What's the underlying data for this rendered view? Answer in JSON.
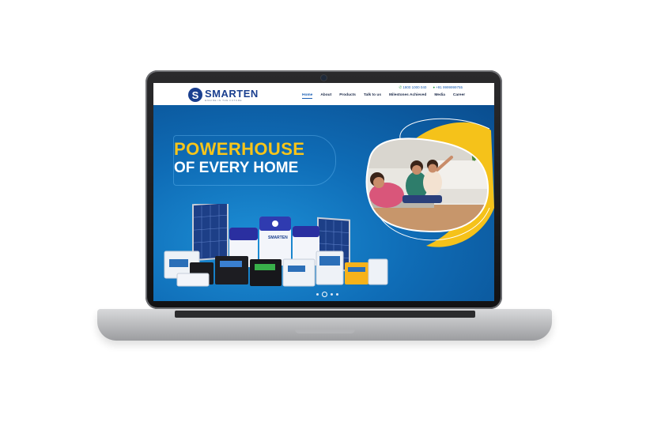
{
  "site": {
    "logo_letter": "S",
    "logo_name": "SMARTEN",
    "logo_tagline": "ENGINE IN THE FUTURE"
  },
  "contact": {
    "phone": "1800 1000 040",
    "whatsapp": "+91 9999999755"
  },
  "nav": {
    "items": [
      "Home",
      "About",
      "Products",
      "Talk to us",
      "Milestones Achieved",
      "Media",
      "Career"
    ],
    "active": "Home"
  },
  "hero": {
    "line1": "POWERHOUSE",
    "line2": "OF EVERY HOME",
    "product_brand": "SMARTEN"
  },
  "slider": {
    "count": 4,
    "active_index": 1
  },
  "colors": {
    "brand": "#1a3f8f",
    "accent": "#f7c51a",
    "hero_bg": "#0f6db7"
  }
}
